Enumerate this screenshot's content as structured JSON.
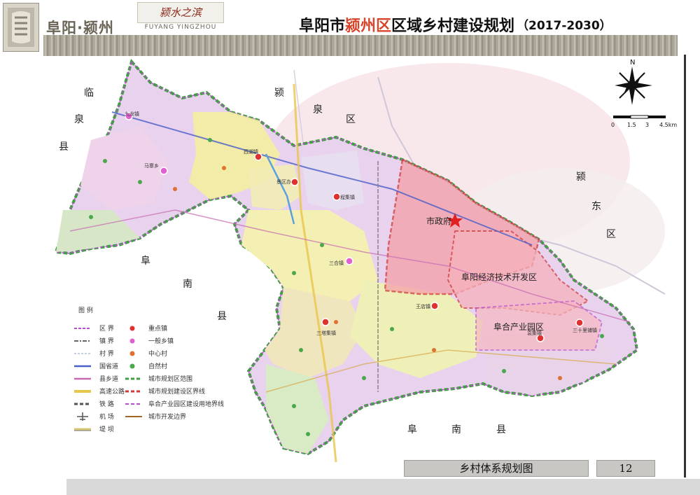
{
  "header": {
    "brand": "阜阳·颍州",
    "slogan": "颍水之滨",
    "slogan_en": "FUYANG YINGZHOU",
    "title_prefix": "阜阳市",
    "title_highlight": "颍州区",
    "title_suffix": "区域乡村建设规划",
    "title_years": "（2017-2030）"
  },
  "map": {
    "neighbors": [
      {
        "name": "临",
        "role": "linquan-1"
      },
      {
        "name": "泉",
        "role": "linquan-2"
      },
      {
        "name": "县",
        "role": "linquan-3"
      },
      {
        "name": "颍",
        "role": "yingquan-1"
      },
      {
        "name": "泉",
        "role": "yingquan-2"
      },
      {
        "name": "区",
        "role": "yingquan-3"
      },
      {
        "name": "颍",
        "role": "yingdong-1"
      },
      {
        "name": "东",
        "role": "yingdong-2"
      },
      {
        "name": "区",
        "role": "yingdong-3"
      },
      {
        "name": "阜",
        "role": "funan-w-1"
      },
      {
        "name": "南",
        "role": "funan-w-2"
      },
      {
        "name": "县",
        "role": "funan-w-3"
      },
      {
        "name": "阜",
        "role": "funan-s-1"
      },
      {
        "name": "南",
        "role": "funan-s-2"
      },
      {
        "name": "县",
        "role": "funan-s-3"
      }
    ],
    "towns": [
      {
        "name": "九龙镇",
        "type": "一般乡镇"
      },
      {
        "name": "马寨乡",
        "type": "一般乡镇"
      },
      {
        "name": "西湖镇",
        "type": "重点镇"
      },
      {
        "name": "景区办",
        "type": "重点镇"
      },
      {
        "name": "程集镇",
        "type": "重点镇"
      },
      {
        "name": "三合镇",
        "type": "一般乡镇"
      },
      {
        "name": "三塔集镇",
        "type": "重点镇"
      },
      {
        "name": "王店镇",
        "type": "重点镇"
      },
      {
        "name": "袁集镇",
        "type": "重点镇"
      },
      {
        "name": "三十里铺镇",
        "type": "重点镇"
      }
    ],
    "city_hall": "市政府",
    "zones": [
      "阜阳经济技术开发区",
      "阜合产业园区"
    ],
    "compass_label": "N",
    "scale_labels": [
      "0",
      "1.5",
      "3",
      "4.5km"
    ],
    "colors": {
      "district_pink": "#f2b8c6",
      "urban_red": "#f4a0a8",
      "town_yellow": "#f3eea0",
      "rural_green": "#cfe6b5",
      "boundary_green": "#3aa23a",
      "boundary_purple": "#b94fd0",
      "expressway": "#e8c64a",
      "highway_blue": "#4a5fc8"
    }
  },
  "legend": {
    "title": "图    例",
    "left_items": [
      {
        "label": "区    界",
        "style": "district-boundary"
      },
      {
        "label": "镇    界",
        "style": "town-boundary"
      },
      {
        "label": "村    界",
        "style": "village-boundary"
      },
      {
        "label": "国省道",
        "style": "national-road"
      },
      {
        "label": "县乡道",
        "style": "county-road"
      },
      {
        "label": "高速公路",
        "style": "expressway"
      },
      {
        "label": "铁    路",
        "style": "railway"
      },
      {
        "label": "机    场",
        "style": "airport"
      },
      {
        "label": "堤    坝",
        "style": "dam"
      }
    ],
    "right_items": [
      {
        "label": "重点镇",
        "style": "key-town"
      },
      {
        "label": "一般乡镇",
        "style": "general-town"
      },
      {
        "label": "中心村",
        "style": "central-village"
      },
      {
        "label": "自然村",
        "style": "natural-village"
      },
      {
        "label": "城市规划区范围",
        "style": "planning-area"
      },
      {
        "label": "城市规划建设区界线",
        "style": "construction-boundary"
      },
      {
        "label": "阜合产业园区建设用地界线",
        "style": "industrial-boundary"
      },
      {
        "label": "城市开发边界",
        "style": "development-boundary"
      }
    ]
  },
  "footer": {
    "section_title": "乡村体系规划图",
    "page_number": "12"
  }
}
